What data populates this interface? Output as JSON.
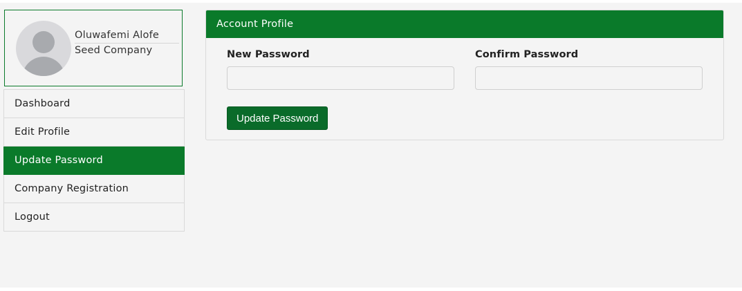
{
  "profile": {
    "name": "Oluwafemi Alofe",
    "company": "Seed Company"
  },
  "sidebar": {
    "items": [
      {
        "label": "Dashboard"
      },
      {
        "label": "Edit Profile"
      },
      {
        "label": "Update Password",
        "active": true
      },
      {
        "label": "Company Registration"
      },
      {
        "label": "Logout"
      }
    ]
  },
  "panel": {
    "title": "Account Profile",
    "new_password_label": "New Password",
    "new_password_value": "",
    "confirm_password_label": "Confirm Password",
    "confirm_password_value": "",
    "submit_label": "Update Password"
  },
  "colors": {
    "accent": "#0a7a2a",
    "background": "#f4f4f4"
  }
}
